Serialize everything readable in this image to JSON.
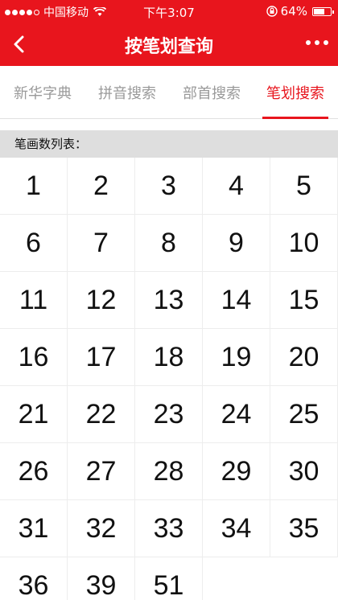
{
  "status_bar": {
    "carrier": "中国移动",
    "time": "下午3:07",
    "battery_text": "64%",
    "battery_level": 0.64,
    "signal_bars_filled": 4,
    "signal_bars_total": 5
  },
  "nav": {
    "title": "按笔划查询",
    "back_icon": "chevron-left-icon",
    "more_icon": "more-dots-icon"
  },
  "tabs": [
    {
      "label": "新华字典",
      "active": false
    },
    {
      "label": "拼音搜索",
      "active": false
    },
    {
      "label": "部首搜索",
      "active": false
    },
    {
      "label": "笔划搜索",
      "active": true
    }
  ],
  "section_title": "笔画数列表：",
  "stroke_counts": [
    "1",
    "2",
    "3",
    "4",
    "5",
    "6",
    "7",
    "8",
    "9",
    "10",
    "11",
    "12",
    "13",
    "14",
    "15",
    "16",
    "17",
    "18",
    "19",
    "20",
    "21",
    "22",
    "23",
    "24",
    "25",
    "26",
    "27",
    "28",
    "29",
    "30",
    "31",
    "32",
    "33",
    "34",
    "35",
    "36",
    "39",
    "51"
  ],
  "colors": {
    "accent": "#e8151d",
    "tab_inactive": "#9a9a9a",
    "section_bg": "#dedede"
  }
}
